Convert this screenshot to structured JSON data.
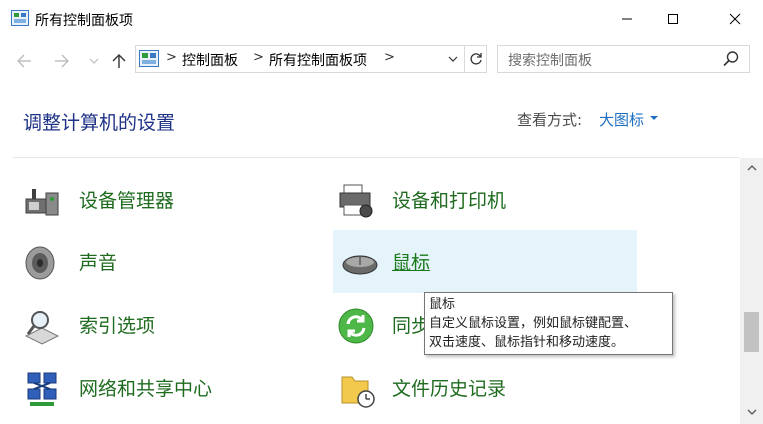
{
  "window": {
    "title": "所有控制面板项",
    "minimize_icon": "minimize-icon",
    "maximize_icon": "maximize-icon",
    "close_icon": "close-icon"
  },
  "nav": {
    "back_icon": "back-arrow-icon",
    "forward_icon": "forward-arrow-icon",
    "recent_icon": "chevron-down-icon",
    "up_icon": "up-arrow-icon"
  },
  "address": {
    "crumbs": [
      "控制面板",
      "所有控制面板项"
    ],
    "separator": ">"
  },
  "search": {
    "placeholder": "搜索控制面板"
  },
  "header": {
    "title": "调整计算机的设置",
    "view_by_label": "查看方式:",
    "view_by_value": "大图标"
  },
  "items": [
    {
      "label": "设备管理器",
      "icon": "device-manager-icon"
    },
    {
      "label": "设备和打印机",
      "icon": "printer-icon"
    },
    {
      "label": "声音",
      "icon": "speaker-icon"
    },
    {
      "label": "鼠标",
      "icon": "mouse-icon"
    },
    {
      "label": "索引选项",
      "icon": "indexing-icon"
    },
    {
      "label": "同步中心",
      "icon": "sync-icon"
    },
    {
      "label": "网络和共享中心",
      "icon": "network-icon"
    },
    {
      "label": "文件历史记录",
      "icon": "file-history-icon"
    }
  ],
  "tooltip": {
    "title": "鼠标",
    "line1": "自定义鼠标设置，例如鼠标键配置、",
    "line2": "双击速度、鼠标指针和移动速度。"
  },
  "colors": {
    "heading": "#1e3287",
    "link_green": "#1f6b1f",
    "hover_bg": "#e5f3fb",
    "accent_blue": "#1e6fbf"
  }
}
